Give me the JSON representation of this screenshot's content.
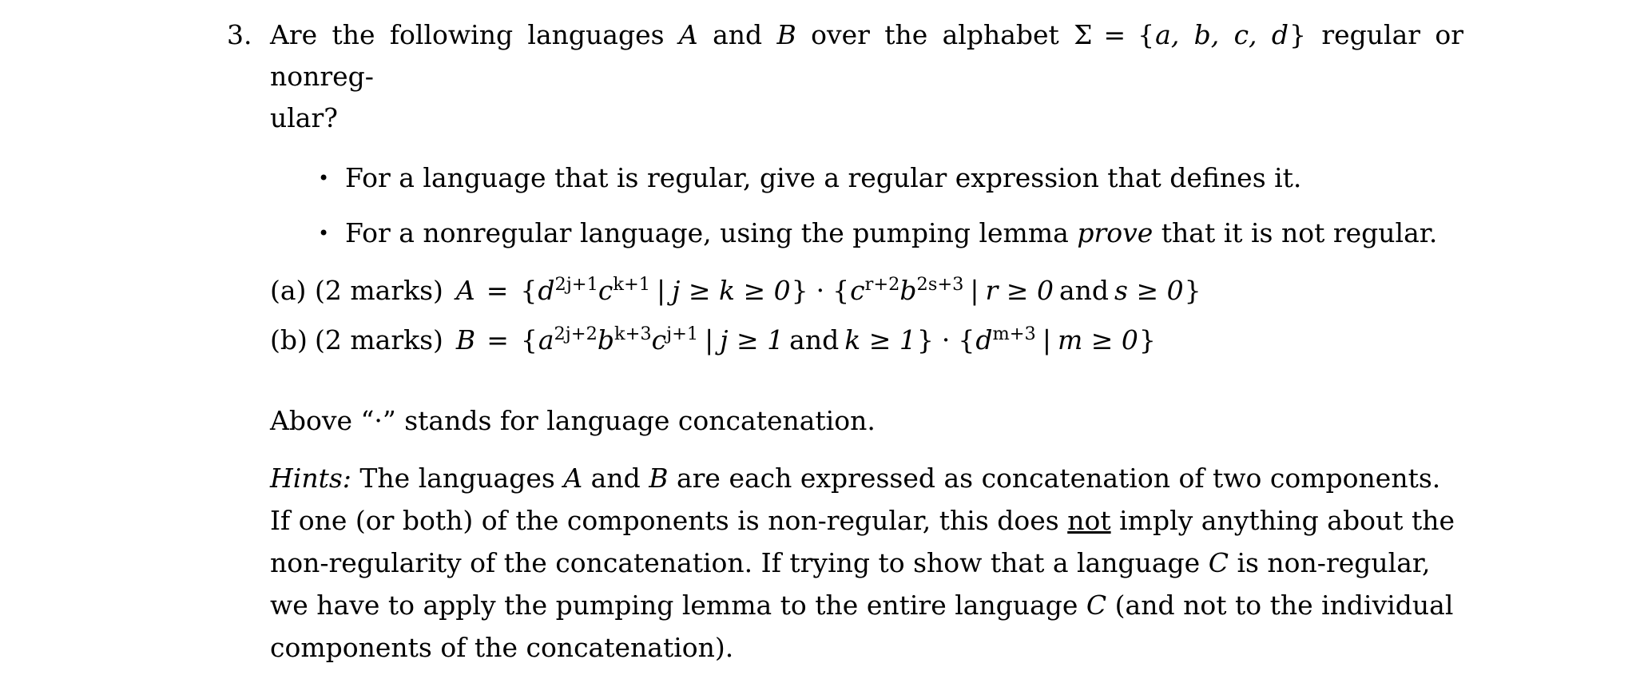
{
  "document": {
    "problem_number": "3.",
    "stem_line1": "Are the following languages A and B over the alphabet Σ = {a, b, c, d} regular or nonreg-",
    "stem_line2": "ular?",
    "stem": {
      "text_before_A": "Are the following languages",
      "var_A": "A",
      "text_and": "and",
      "var_B": "B",
      "text_over": "over the alphabet",
      "sigma": "Σ",
      "equals": "=",
      "alphabet_open": "{",
      "alphabet": "a, b, c, d",
      "alphabet_close": "}",
      "text_after": "regular or nonreg-",
      "continuation": "ular?"
    },
    "bullets": [
      {
        "marker": "•",
        "parts": [
          {
            "text": "For a language that is regular, give a regular expression that defines it.",
            "style": "normal"
          }
        ]
      },
      {
        "marker": "•",
        "parts": [
          {
            "text": "For a nonregular language, using the pumping lemma ",
            "style": "normal"
          },
          {
            "text": "prove",
            "style": "italic"
          },
          {
            "text": " that it is not regular.",
            "style": "normal"
          }
        ]
      }
    ],
    "subitems": [
      {
        "label": "(a)",
        "marks": "(2 marks)",
        "latex": "A = \\{d^{2j+1}c^{k+1} \\mid j \\geq k \\geq 0\\} \\cdot \\{c^{r+2}b^{2s+3} \\mid r \\geq 0 \\text{ and } s \\geq 0\\}",
        "plain": "A = {d^{2j+1}c^{k+1} | j ≥ k ≥ 0} · {c^{r+2}b^{2s+3} | r ≥ 0 and s ≥ 0}",
        "lhs": "A",
        "equals": "=",
        "set1": {
          "open": "{",
          "base1": "d",
          "exp1": "2j+1",
          "base2": "c",
          "exp2": "k+1",
          "mid": "|",
          "cond": "j ≥ k ≥ 0",
          "close": "}"
        },
        "operator": "·",
        "set2": {
          "open": "{",
          "base1": "c",
          "exp1": "r+2",
          "base2": "b",
          "exp2": "2s+3",
          "mid": "|",
          "cond_a": "r ≥ 0",
          "cond_join": "and",
          "cond_b": "s ≥ 0",
          "close": "}"
        }
      },
      {
        "label": "(b)",
        "marks": "(2 marks)",
        "latex": "B = \\{a^{2j+2}b^{k+3}c^{j+1} \\mid j \\geq 1 \\text{ and } k \\geq 1\\} \\cdot \\{d^{m+3} \\mid m \\geq 0\\}",
        "plain": "B = {a^{2j+2}b^{k+3}c^{j+1} | j ≥ 1 and k ≥ 1} · {d^{m+3} | m ≥ 0}",
        "lhs": "B",
        "equals": "=",
        "set1": {
          "open": "{",
          "base1": "a",
          "exp1": "2j+2",
          "base2": "b",
          "exp2": "k+3",
          "base3": "c",
          "exp3": "j+1",
          "mid": "|",
          "cond_a": "j ≥ 1",
          "cond_join": "and",
          "cond_b": "k ≥ 1",
          "close": "}"
        },
        "operator": "·",
        "set2": {
          "open": "{",
          "base1": "d",
          "exp1": "m+3",
          "mid": "|",
          "cond": "m ≥ 0",
          "close": "}"
        }
      }
    ],
    "above_note": {
      "prefix": "Above",
      "quoted_symbol": "“·”",
      "suffix": "stands for language concatenation."
    },
    "hints": {
      "label": "Hints:",
      "full_text": "Hints: The languages A and B are each expressed as concatenation of two components. If one (or both) of the components is non-regular, this does not imply anything about the non-regularity of the concatenation. If trying to show that a language C is non-regular, we have to apply the pumping lemma to the entire language C (and not to the individual components of the concatenation).",
      "line1_a": "The languages",
      "line1_var1": "A",
      "line1_b": "and",
      "line1_var2": "B",
      "line1_c": "are each expressed as concatenation of two components.",
      "line2_a": "If one (or both) of the components is non-regular, this does",
      "line2_underlined": "not",
      "line2_b": "imply anything about the",
      "line3_a": "non-regularity of the concatenation. If trying to show that a language",
      "line3_var": "C",
      "line3_b": "is non-regular,",
      "line4_a": "we have to apply the pumping lemma to the entire language",
      "line4_var": "C",
      "line4_b": "(and not to the individual",
      "line5": "components of the concatenation)."
    }
  }
}
